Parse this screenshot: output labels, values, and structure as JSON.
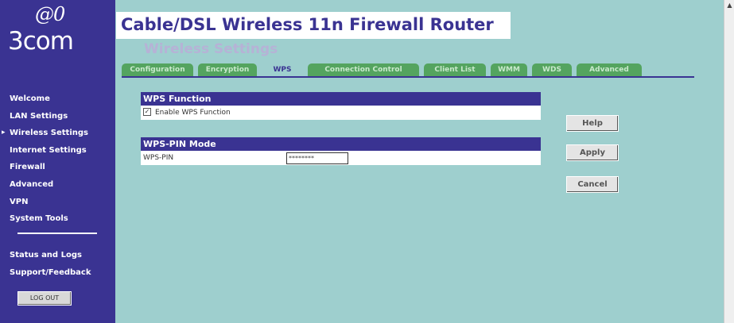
{
  "brand": {
    "logo_mark": "@0",
    "logo_text": "3com"
  },
  "sidebar": {
    "items": [
      {
        "label": "Welcome"
      },
      {
        "label": "LAN Settings"
      },
      {
        "label": "Wireless Settings",
        "active": true
      },
      {
        "label": "Internet Settings"
      },
      {
        "label": "Firewall"
      },
      {
        "label": "Advanced"
      },
      {
        "label": "VPN"
      },
      {
        "label": "System Tools"
      }
    ],
    "secondary": [
      {
        "label": "Status and Logs"
      },
      {
        "label": "Support/Feedback"
      }
    ],
    "logout_label": "LOG OUT"
  },
  "header": {
    "title": "Cable/DSL Wireless 11n Firewall Router",
    "subtitle": "Wireless Settings"
  },
  "tabs": [
    "Configuration",
    "Encryption",
    "WPS",
    "Connection Control",
    "Client List",
    "WMM",
    "WDS",
    "Advanced"
  ],
  "active_tab": "WPS",
  "wps_function": {
    "header": "WPS Function",
    "enable_label": "Enable WPS Function",
    "enable_checked": true,
    "check_glyph": "✓"
  },
  "wps_pin": {
    "header": "WPS-PIN Mode",
    "label": "WPS-PIN",
    "value": "********"
  },
  "buttons": {
    "help": "Help",
    "apply": "Apply",
    "cancel": "Cancel"
  },
  "scrollbar": {
    "up_arrow": "▲"
  },
  "colors": {
    "brand": "#3a3392",
    "content_bg": "#9ecfce",
    "tab": "#54a45f"
  }
}
